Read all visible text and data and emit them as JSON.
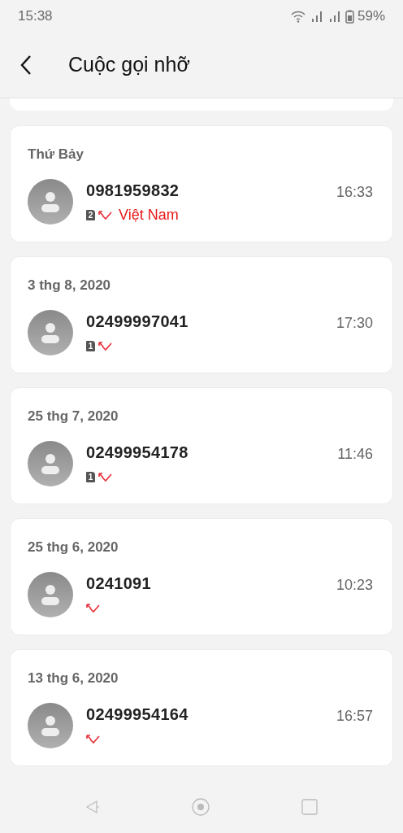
{
  "status_bar": {
    "time": "15:38",
    "battery": "59%"
  },
  "header": {
    "title": "Cuộc gọi nhỡ"
  },
  "calls": [
    {
      "date": "Thứ Bảy",
      "number": "0981959832",
      "time": "16:33",
      "sim": "2",
      "location": "Việt Nam"
    },
    {
      "date": "3 thg 8, 2020",
      "number": "02499997041",
      "time": "17:30",
      "sim": "1"
    },
    {
      "date": "25 thg 7, 2020",
      "number": "02499954178",
      "time": "11:46",
      "sim": "1"
    },
    {
      "date": "25 thg 6, 2020",
      "number": "0241091",
      "time": "10:23"
    },
    {
      "date": "13 thg 6, 2020",
      "number": "02499954164",
      "time": "16:57"
    }
  ]
}
